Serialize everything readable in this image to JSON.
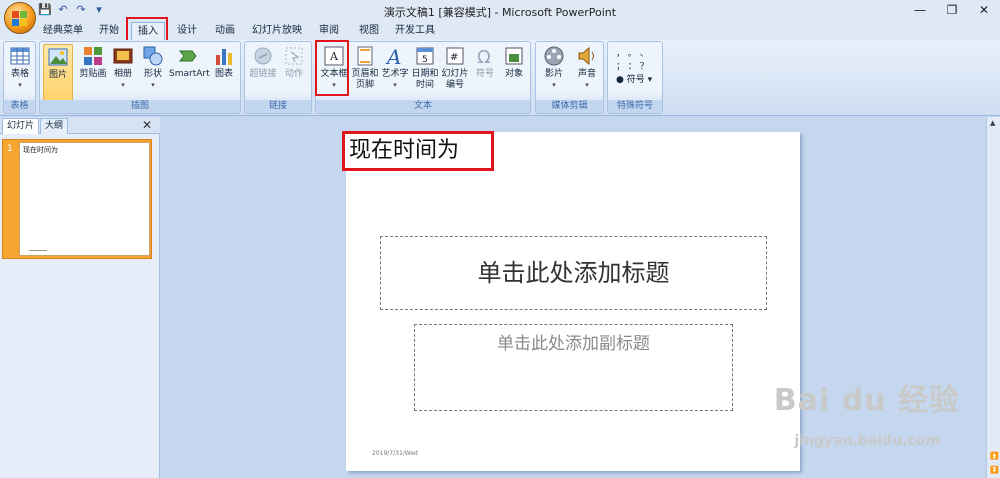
{
  "window": {
    "title": "演示文稿1 [兼容模式] - Microsoft PowerPoint",
    "controls": [
      "—",
      "❐",
      "✕"
    ]
  },
  "qat": [
    "💾",
    "↶",
    "↷",
    "▾"
  ],
  "tabs": [
    {
      "label": "经典菜单"
    },
    {
      "label": "开始"
    },
    {
      "label": "插入"
    },
    {
      "label": "设计"
    },
    {
      "label": "动画"
    },
    {
      "label": "幻灯片放映"
    },
    {
      "label": "审阅"
    },
    {
      "label": "视图"
    },
    {
      "label": "开发工具"
    }
  ],
  "help": "?",
  "ribbon": {
    "groups": [
      {
        "label": "表格"
      },
      {
        "label": "插图"
      },
      {
        "label": "链接"
      },
      {
        "label": "文本"
      },
      {
        "label": "媒体剪辑"
      },
      {
        "label": "特殊符号"
      }
    ],
    "table": {
      "label": "表格"
    },
    "picture": {
      "label": "图片"
    },
    "clipart": {
      "label": "剪贴画"
    },
    "album": {
      "label": "相册"
    },
    "shapes": {
      "label": "形状"
    },
    "smartart": {
      "label": "SmartArt"
    },
    "chart": {
      "label": "图表"
    },
    "hyperlink": {
      "label": "超链接"
    },
    "action": {
      "label": "动作"
    },
    "textbox": {
      "label": "文本框"
    },
    "header": {
      "line1": "页眉和",
      "line2": "页脚"
    },
    "wordart": {
      "label": "艺术字"
    },
    "datetime": {
      "line1": "日期和",
      "line2": "时间"
    },
    "slidenum": {
      "line1": "幻灯片",
      "line2": "编号"
    },
    "symbol": {
      "label": "符号"
    },
    "object": {
      "label": "对象"
    },
    "movie": {
      "label": "影片"
    },
    "sound": {
      "label": "声音"
    },
    "special": {
      "row1": "，  。  、",
      "row2": "；  ：  ？",
      "row3": "符号"
    }
  },
  "leftpane": {
    "tab_slides": "幻灯片",
    "tab_outline": "大纲",
    "close": "✕",
    "slide_number": "1",
    "thumb_text": "现在时间为"
  },
  "slide": {
    "textbox_text": "现在时间为",
    "title_placeholder": "单击此处添加标题",
    "subtitle_placeholder": "单击此处添加副标题",
    "date": "2019/7/31/Wed"
  },
  "watermark": {
    "text": "Bai du 经验",
    "sub": "jingyan.baidu.com"
  },
  "colors": {
    "highlight_box": "#e0161c",
    "ribbon_bg": "#dfe9f5",
    "selected_thumb": "#f6a531"
  }
}
